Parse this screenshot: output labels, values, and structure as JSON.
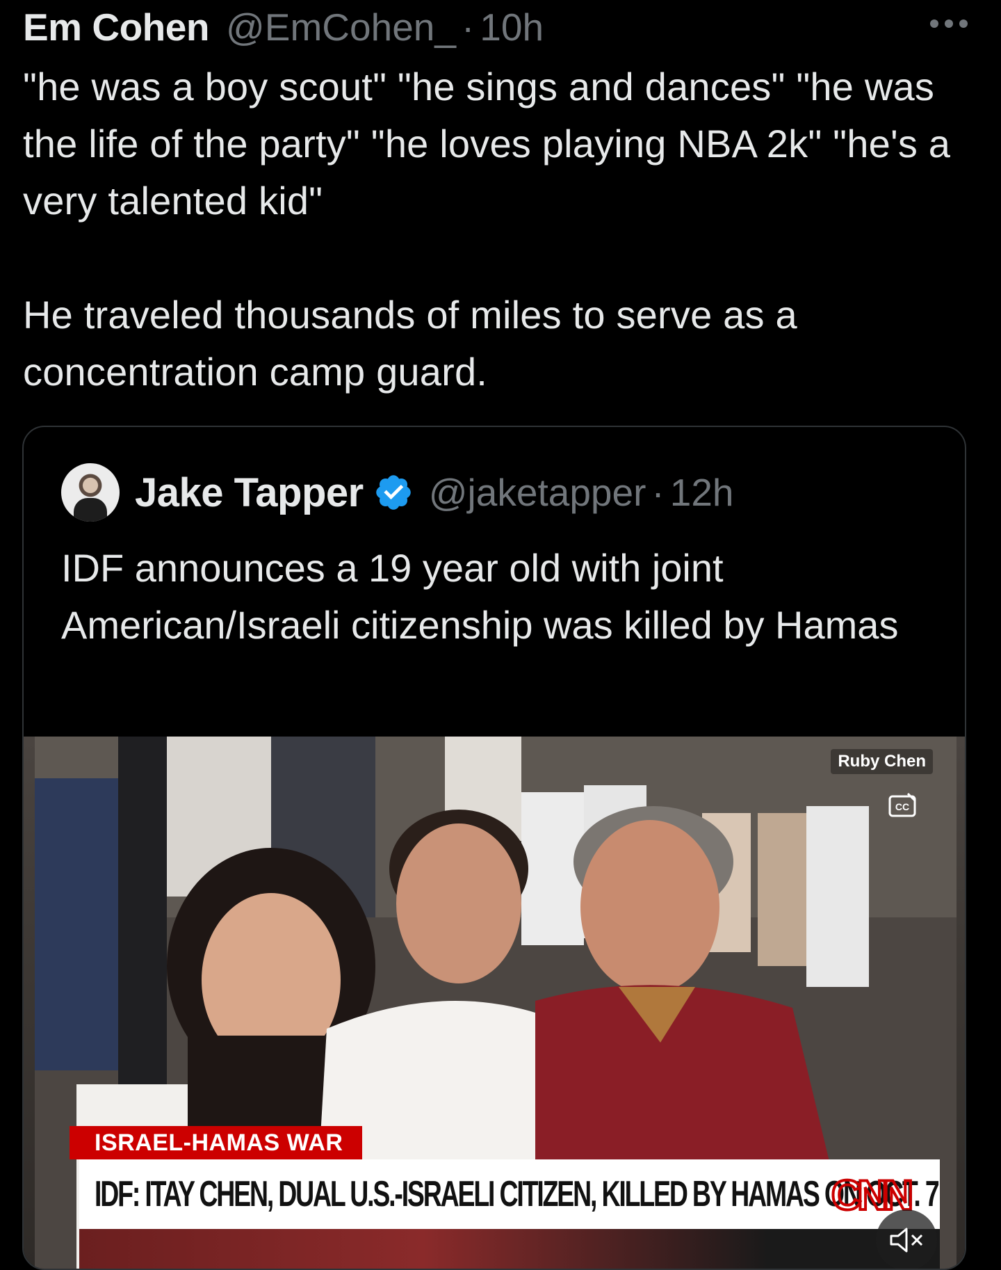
{
  "tweet": {
    "author_name": "Em Cohen",
    "author_handle": "@EmCohen_",
    "separator": "·",
    "time": "10h",
    "body_line1": "\"he was a boy scout\" \"he sings and dances\" \"he was the life of the party\" \"he loves playing NBA 2k\" \"he's a very talented kid\"",
    "body_line2": "He traveled thousands of miles to serve as a concentration camp guard.",
    "more_icon": "ellipsis-icon"
  },
  "quoted_tweet": {
    "author_name": "Jake Tapper",
    "author_handle": "@jaketapper",
    "separator": "·",
    "time": "12h",
    "verified_icon": "verified-badge-icon",
    "text": "IDF announces a 19 year old with joint American/Israeli citizenship was killed by Hamas"
  },
  "media": {
    "photo_credit": "Ruby Chen",
    "chyron_tag": "ISRAEL-HAMAS WAR",
    "chyron_headline": "IDF: ITAY CHEN, DUAL U.S.-ISRAELI CITIZEN, KILLED BY HAMAS ON OCT. 7",
    "network_logo": "CNN",
    "cc_icon": "closed-captions-icon",
    "mute_icon": "speaker-muted-icon"
  },
  "colors": {
    "background": "#000000",
    "text_primary": "#e7e9ea",
    "text_secondary": "#71767b",
    "verified_blue": "#1d9bf0",
    "border": "#2f3336",
    "cnn_red": "#cc0000"
  }
}
